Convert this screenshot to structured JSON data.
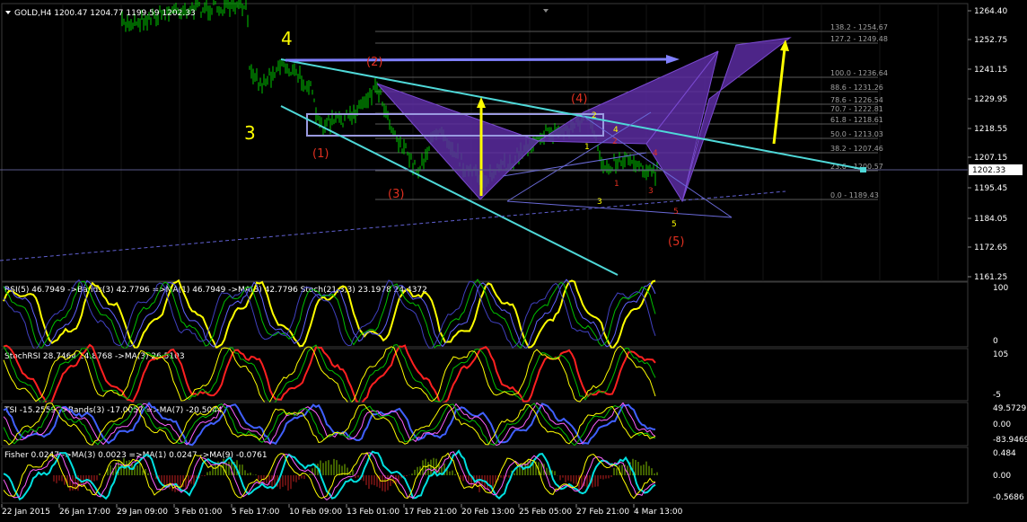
{
  "colors": {
    "background": "#000000",
    "grid": "#1a1a1a",
    "candles": "#00cc00",
    "trendline": "#4fd8d8",
    "fib": "#808080",
    "pattern_fill": "#5a2ca0",
    "arrow": "#ffff00",
    "wave_yellow": "#ffff00",
    "wave_red": "#e03020",
    "rsi": "#ffff00",
    "stoch_red": "#ff2020",
    "stoch_green": "#00c000",
    "tsi_blue": "#4060ff",
    "fisher_cyan": "#00e0e0"
  },
  "main": {
    "header": "GOLD,H4  1200.47 1204.77 1199.59 1202.33",
    "current_price": "1202.33",
    "y_ticks": [
      "1264.40",
      "1252.75",
      "1241.15",
      "1229.95",
      "1218.55",
      "1207.15",
      "1195.45",
      "1184.05",
      "1172.65",
      "1161.25"
    ],
    "fib_levels": [
      "138.2 - 1254.67",
      "127.2 - 1249.48",
      "100.0 - 1236.64",
      "88.6 - 1231.26",
      "78.6 - 1226.54",
      "70.7 - 1222.81",
      "61.8 - 1218.61",
      "50.0 - 1213.03",
      "38.2 - 1207.46",
      "23.6 - 1200.57",
      "0.0 - 1189.43"
    ],
    "wave_labels": {
      "big_4": "4",
      "big_3": "3",
      "w1": "(1)",
      "w2": "(2)",
      "w3": "(3)",
      "w4": "(4)",
      "w5": "(5)",
      "small": [
        "1",
        "2",
        "3",
        "4",
        "5",
        "1",
        "2",
        "3",
        "4",
        "5"
      ]
    }
  },
  "indicators": [
    {
      "header": "RSI(5) 46.7949  ->Bands(3) 42.7796  =>MA(1) 46.7949  ->MA(3) 42.7796  Stoch(21,3,3) 23.1978 24.4372",
      "axis": [
        "100",
        "0"
      ]
    },
    {
      "header": "StochRSI 28.7464 24.8768  ->MA(3) 26.5103",
      "axis": [
        "105",
        "-5"
      ]
    },
    {
      "header": "TSI -15.2559  ->Bands(3) -17.0057  =>MA(7) -20.5044",
      "axis": [
        "49.5729",
        "0.00",
        "-83.9469"
      ]
    },
    {
      "header": "Fisher 0.0247  ->MA(3) 0.0023  =>MA(1) 0.0247  ->MA(9) -0.0761",
      "axis": [
        "0.484",
        "0.00",
        "-0.5686"
      ]
    }
  ],
  "x_axis": [
    "22 Jan 2015",
    "26 Jan 17:00",
    "29 Jan 09:00",
    "3 Feb 01:00",
    "5 Feb 17:00",
    "10 Feb 09:00",
    "13 Feb 01:00",
    "17 Feb 21:00",
    "20 Feb 13:00",
    "25 Feb 05:00",
    "27 Feb 21:00",
    "4 Mar 13:00"
  ]
}
